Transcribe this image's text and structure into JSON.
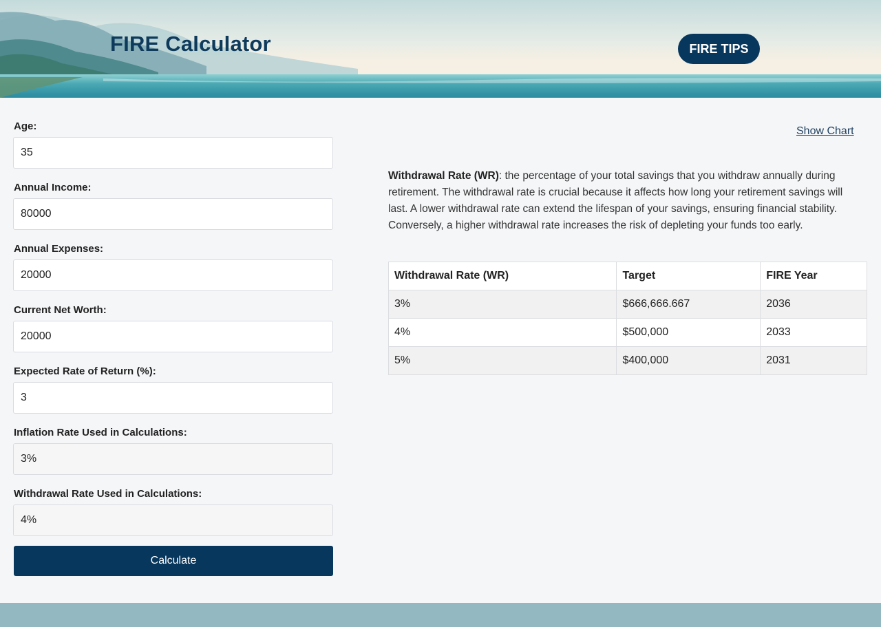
{
  "header": {
    "title": "FIRE Calculator",
    "tips_label": "FIRE TIPS"
  },
  "form": {
    "fields": [
      {
        "label": "Age:",
        "value": "35"
      },
      {
        "label": "Annual Income:",
        "value": "80000"
      },
      {
        "label": "Annual Expenses:",
        "value": "20000"
      },
      {
        "label": "Current Net Worth:",
        "value": "20000"
      },
      {
        "label": "Expected Rate of Return (%):",
        "value": "3"
      },
      {
        "label": "Inflation Rate Used in Calculations:",
        "value": "3%"
      },
      {
        "label": "Withdrawal Rate Used in Calculations:",
        "value": "4%"
      }
    ],
    "calculate_label": "Calculate"
  },
  "results": {
    "show_chart_label": "Show Chart",
    "description_term": "Withdrawal Rate (WR)",
    "description_text": ": the percentage of your total savings that you withdraw annually during retirement. The withdrawal rate is crucial because it affects how long your retirement savings will last. A lower withdrawal rate can extend the lifespan of your savings, ensuring financial stability. Conversely, a higher withdrawal rate increases the risk of depleting your funds too early.",
    "table": {
      "headers": [
        "Withdrawal Rate (WR)",
        "Target",
        "FIRE Year"
      ],
      "rows": [
        [
          "3%",
          "$666,666.667",
          "2036"
        ],
        [
          "4%",
          "$500,000",
          "2033"
        ],
        [
          "5%",
          "$400,000",
          "2031"
        ]
      ]
    }
  },
  "colors": {
    "primary": "#07375c",
    "title": "#0e3a5c",
    "footer": "#94b8c2",
    "background": "#f5f6f8"
  }
}
